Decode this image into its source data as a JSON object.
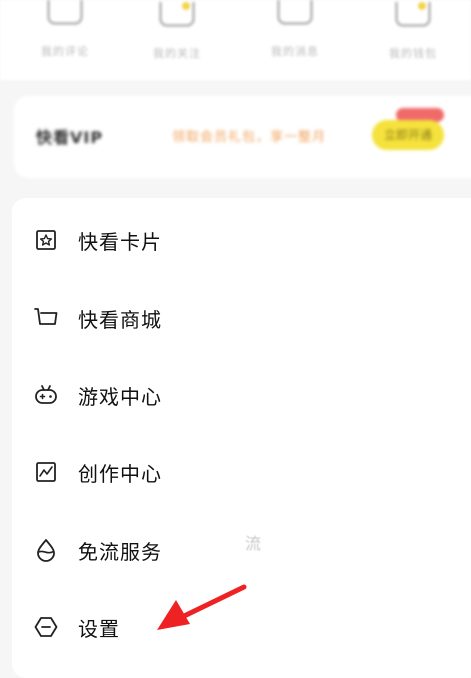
{
  "shortcuts": [
    {
      "label": "我的评论"
    },
    {
      "label": "我的关注"
    },
    {
      "label": "我的消息"
    },
    {
      "label": "我的钱包"
    }
  ],
  "vip": {
    "title": "快看VIP",
    "promo": "领取会员礼包，享一整月",
    "button": "立即开通"
  },
  "menu": [
    {
      "label": "快看卡片",
      "icon": "card-icon"
    },
    {
      "label": "快看商城",
      "icon": "shopping-cart-icon"
    },
    {
      "label": "游戏中心",
      "icon": "gamepad-icon"
    },
    {
      "label": "创作中心",
      "icon": "chart-icon"
    },
    {
      "label": "免流服务",
      "icon": "water-drop-icon"
    },
    {
      "label": "设置",
      "icon": "settings-icon"
    }
  ],
  "side_text": "流",
  "colors": {
    "arrow": "#ee2222",
    "vip_button": "#f5e23c",
    "promo_text": "#f1a35c",
    "background": "#f6f6f6"
  }
}
